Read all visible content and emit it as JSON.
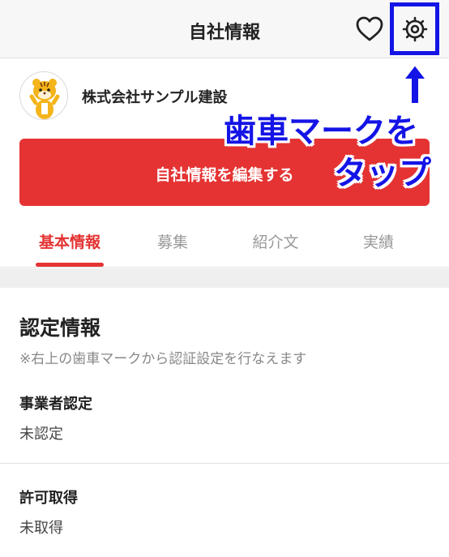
{
  "header": {
    "title": "自社情報",
    "heart_icon": "heart-icon",
    "gear_icon": "gear-icon"
  },
  "company": {
    "name": "株式会社サンプル建設",
    "avatar": "tiger-mascot"
  },
  "edit_button": {
    "label": "自社情報を編集する"
  },
  "tabs": [
    {
      "label": "基本情報",
      "active": true
    },
    {
      "label": "募集",
      "active": false
    },
    {
      "label": "紹介文",
      "active": false
    },
    {
      "label": "実績",
      "active": false
    }
  ],
  "certification": {
    "title": "認定情報",
    "note": "※右上の歯車マークから認証設定を行なえます",
    "items": [
      {
        "label": "事業者認定",
        "value": "未認定"
      },
      {
        "label": "許可取得",
        "value": "未取得"
      }
    ]
  },
  "annotation": {
    "line1": "歯車マークを",
    "line2": "タップ"
  },
  "colors": {
    "accent": "#e53333",
    "annotation": "#1414e6",
    "header_bg": "#f7f7f7"
  }
}
